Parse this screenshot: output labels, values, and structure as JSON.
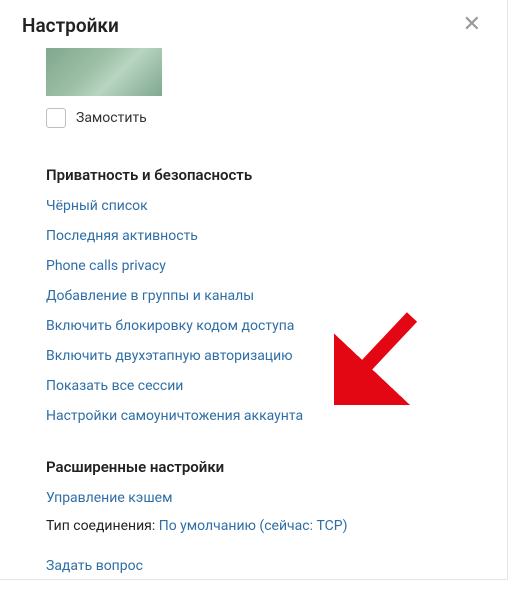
{
  "header": {
    "title": "Настройки"
  },
  "tile": {
    "checkbox_label": "Замостить"
  },
  "privacy": {
    "title": "Приватность и безопасность",
    "links": [
      "Чёрный список",
      "Последняя активность",
      "Phone calls privacy",
      "Добавление в группы и каналы",
      "Включить блокировку кодом доступа",
      "Включить двухэтапную авторизацию",
      "Показать все сессии",
      "Настройки самоуничтожения аккаунта"
    ]
  },
  "advanced": {
    "title": "Расширенные настройки",
    "cache_link": "Управление кэшем",
    "conn_label": "Тип соединения: ",
    "conn_value": "По умолчанию (сейчас: TCP)",
    "ask_link": "Задать вопрос"
  }
}
